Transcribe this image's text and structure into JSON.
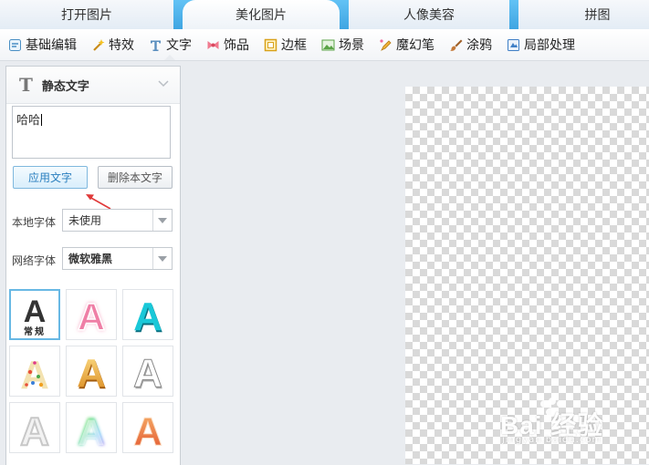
{
  "tabs": [
    {
      "label": "打开图片"
    },
    {
      "label": "美化图片"
    },
    {
      "label": "人像美容"
    },
    {
      "label": "拼图"
    }
  ],
  "toolbar": {
    "items": [
      {
        "label": "基础编辑",
        "icon": "basic-edit-icon"
      },
      {
        "label": "特效",
        "icon": "magic-wand-icon"
      },
      {
        "label": "文字",
        "icon": "text-t-icon"
      },
      {
        "label": "饰品",
        "icon": "bow-icon"
      },
      {
        "label": "边框",
        "icon": "frame-icon"
      },
      {
        "label": "场景",
        "icon": "scene-icon"
      },
      {
        "label": "魔幻笔",
        "icon": "magic-pen-icon"
      },
      {
        "label": "涂鸦",
        "icon": "brush-icon"
      },
      {
        "label": "局部处理",
        "icon": "local-process-icon"
      }
    ],
    "active": "文字"
  },
  "panel": {
    "title": "静态文字",
    "text_value": "哈哈",
    "apply_label": "应用文字",
    "delete_label": "删除本文字",
    "local_font_label": "本地字体",
    "local_font_value": "未使用",
    "web_font_label": "网络字体",
    "web_font_value": "微软雅黑",
    "styles": [
      {
        "caption": "常规"
      }
    ]
  },
  "watermark": {
    "main": "Bai 经验",
    "sub": "jingyan.baidu.com"
  },
  "colors": {
    "accent": "#3fa5e2",
    "annotation_arrow": "#e03a3a"
  }
}
